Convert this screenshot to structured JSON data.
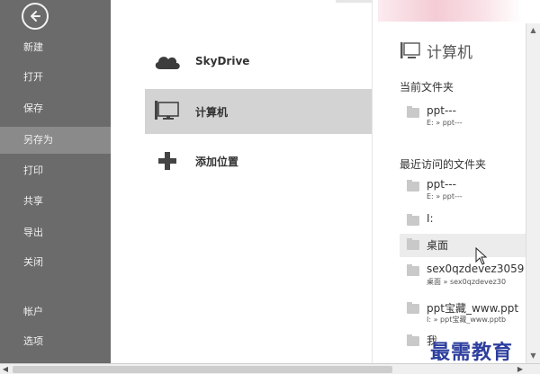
{
  "sidebar": {
    "items": [
      {
        "label": "新建"
      },
      {
        "label": "打开"
      },
      {
        "label": "保存"
      },
      {
        "label": "另存为",
        "active": true
      },
      {
        "label": "打印"
      },
      {
        "label": "共享"
      },
      {
        "label": "导出"
      },
      {
        "label": "关闭"
      },
      {
        "label": "帐户"
      },
      {
        "label": "选项"
      }
    ]
  },
  "places": [
    {
      "label": "SkyDrive",
      "icon": "cloud-icon"
    },
    {
      "label": "计算机",
      "icon": "computer-icon",
      "selected": true
    },
    {
      "label": "添加位置",
      "icon": "plus-icon"
    }
  ],
  "right_panel": {
    "header": "计算机",
    "current_title": "当前文件夹",
    "current_folders": [
      {
        "name": "ppt---",
        "path": "E: » ppt---"
      }
    ],
    "recent_title": "最近访问的文件夹",
    "recent_folders": [
      {
        "name": "ppt---",
        "path": "E: » ppt---"
      },
      {
        "name": "I:",
        "path": ""
      },
      {
        "name": "桌面",
        "path": ""
      },
      {
        "name": "sex0qzdevez3059",
        "path": "桌面 » sex0qzdevez30"
      },
      {
        "name": "ppt宝藏_www.ppt",
        "path": "I: » ppt宝藏_www.pptb"
      },
      {
        "name": "我",
        "path": ""
      }
    ]
  },
  "watermark": "最需教育",
  "colors": {
    "sidebar": "#6b6b6b",
    "sidebar_active": "#8a8a8a",
    "selected": "#d3d3d3"
  }
}
